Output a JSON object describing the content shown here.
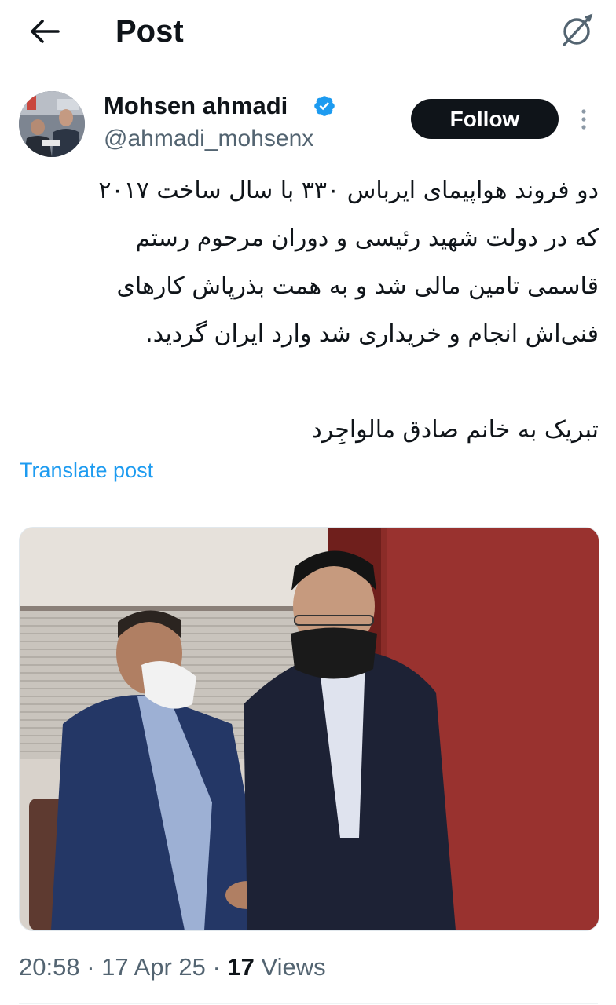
{
  "header": {
    "title": "Post",
    "back_icon": "arrow-left-icon",
    "grok_icon": "grok-icon"
  },
  "author": {
    "display_name": "Mohsen ahmadi",
    "handle": "@ahmadi_mohsenx",
    "verified": true,
    "verified_color": "#1d9bf0"
  },
  "actions": {
    "follow_label": "Follow",
    "more_icon": "more-vertical-icon"
  },
  "tweet": {
    "lines": [
      "دو فروند هواپیمای ایرباس ۳۳۰ با سال ساخت ۲۰۱۷",
      "که در دولت شهید رئیسی و دوران مرحوم رستم",
      "قاسمی تامین مالی شد و به همت بذرپاش کارهای",
      "فنی‌اش انجام و خریداری شد وارد ایران گردید.",
      "تبریک به خانم صادق مالواجِرد"
    ],
    "translate_label": "Translate post",
    "link_color": "#1d9bf0"
  },
  "meta": {
    "time": "20:58",
    "date": "17 Apr 25",
    "views_count": "17",
    "views_label": "Views"
  }
}
